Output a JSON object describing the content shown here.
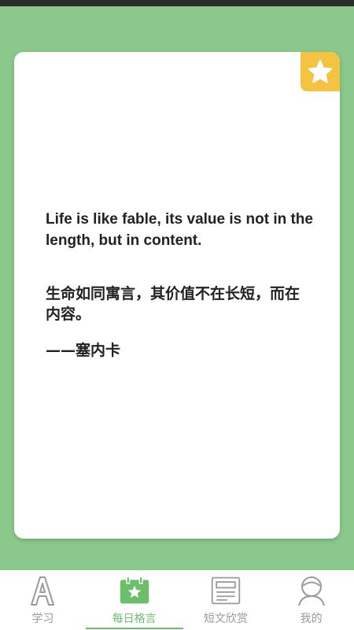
{
  "card": {
    "quote_en": "Life is like fable, its value is not in the length, but in content.",
    "quote_zh": "生命如同寓言，其价值不在长短，而在内容。",
    "author": "——塞内卡",
    "favorite_icon": "star-icon"
  },
  "tabs": [
    {
      "label": "学习",
      "icon": "letter-a-icon",
      "active": false
    },
    {
      "label": "每日格言",
      "icon": "calendar-star-icon",
      "active": true
    },
    {
      "label": "短文欣赏",
      "icon": "document-icon",
      "active": false
    },
    {
      "label": "我的",
      "icon": "person-icon",
      "active": false
    }
  ],
  "colors": {
    "background": "#8bc88b",
    "accent": "#6bbf6b",
    "favorite": "#f5c342",
    "inactive": "#9a9a9a"
  }
}
